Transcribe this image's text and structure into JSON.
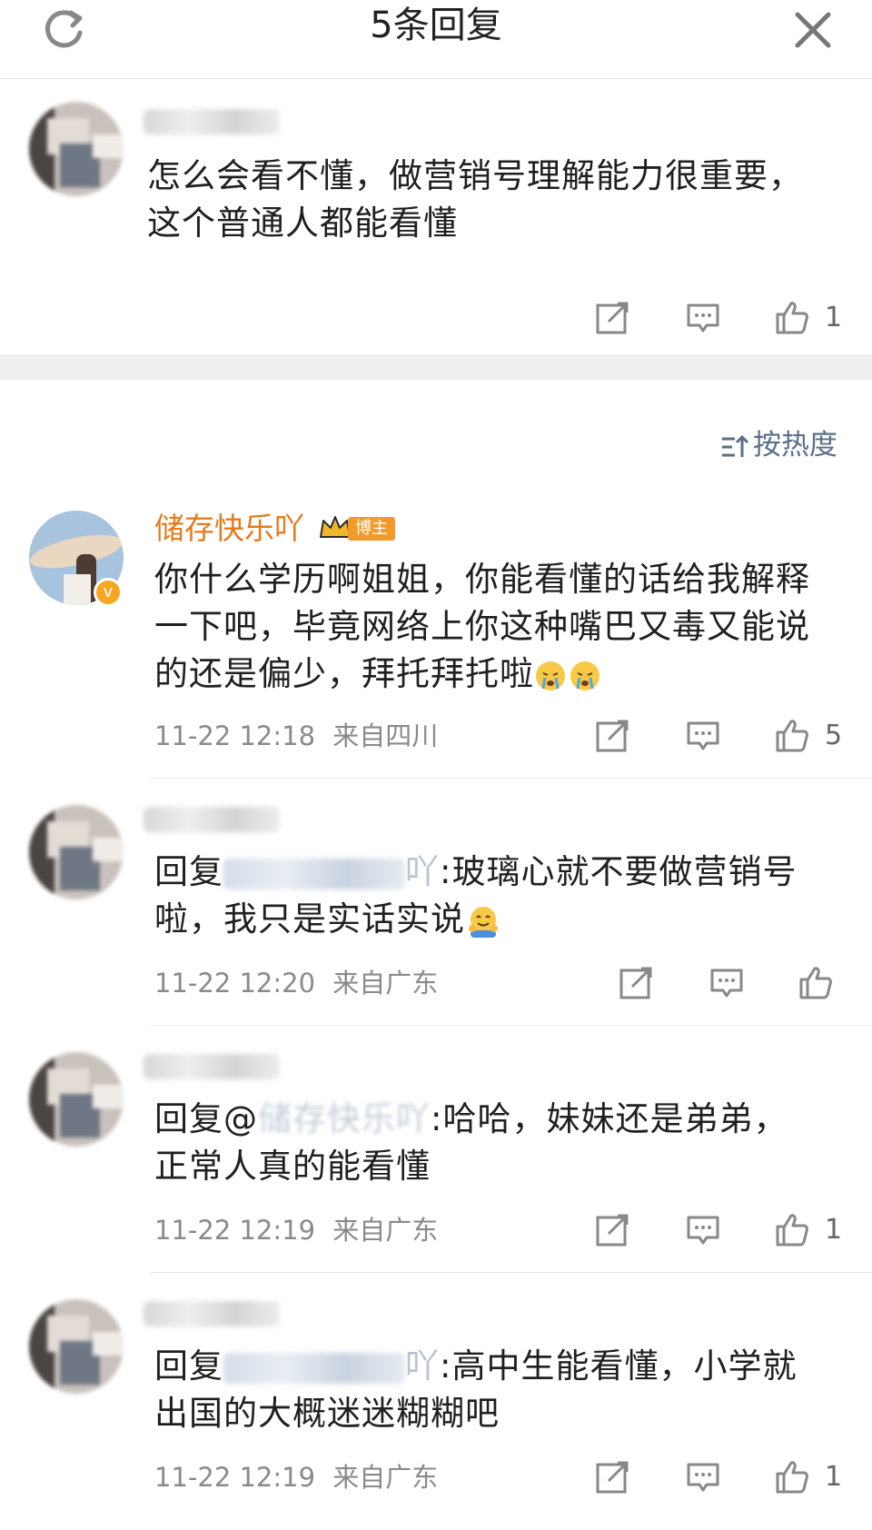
{
  "header": {
    "title": "5条回复",
    "refresh_icon": "refresh-icon",
    "close_icon": "close-icon"
  },
  "root_comment": {
    "text_line1": "怎么会看不懂，做营销号理解能力很重要，",
    "text_line2": "这个普通人都能看懂",
    "like_count": "1"
  },
  "sort": {
    "label": "按热度",
    "icon": "sort-icon"
  },
  "replies": [
    {
      "author": "储存快乐吖",
      "badge": "博主",
      "text_line1": "你什么学历啊姐姐，你能看懂的话给我解释",
      "text_line2": "一下吧，毕竟网络上你这种嘴巴又毒又能说",
      "text_line3": "的还是偏少，拜托拜托啦",
      "time": "11-22 12:18",
      "location": "来自四川",
      "like_count": "5"
    },
    {
      "reply_prefix": "回复",
      "mention_tail": "吖",
      "text_line1_rest": ":玻璃心就不要做营销号",
      "text_line2": "啦，我只是实话实说",
      "time": "11-22 12:20",
      "location": "来自广东",
      "like_count": ""
    },
    {
      "reply_prefix": "回复@",
      "mention_tail": "储存快乐吖",
      "text_line1_rest": ":哈哈，妹妹还是弟弟，",
      "text_line2": "正常人真的能看懂",
      "time": "11-22 12:19",
      "location": "来自广东",
      "like_count": "1"
    },
    {
      "reply_prefix": "回复",
      "mention_tail": "吖",
      "text_line1_rest": ":高中生能看懂，小学就",
      "text_line2": "出国的大概迷迷糊糊吧",
      "time": "11-22 12:19",
      "location": "来自广东",
      "like_count": "1"
    }
  ]
}
